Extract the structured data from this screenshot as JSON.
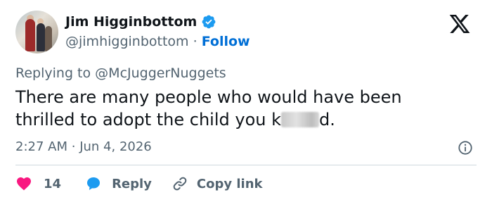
{
  "author": {
    "name": "Jim Higginbottom",
    "handle": "@jimhigginbottom",
    "separator": "·",
    "follow_label": "Follow",
    "verified_color": "#1d9bf0"
  },
  "reply_context": {
    "prefix": "Replying to",
    "mention": "@McJuggerNuggets"
  },
  "tweet": {
    "text_part1": "There are many people who would have been thrilled to adopt the child you k",
    "text_part2": "d."
  },
  "meta": {
    "time": "2:27 AM",
    "separator": "·",
    "date": "Jun 4, 2026"
  },
  "actions": {
    "like_count": "14",
    "reply_label": "Reply",
    "copy_label": "Copy link"
  },
  "colors": {
    "like": "#f91880",
    "reply": "#1d9bf0",
    "link": "#006fd6",
    "muted": "#536471"
  },
  "icons": [
    "verified-badge-icon",
    "x-logo-icon",
    "info-icon",
    "heart-icon",
    "reply-bubble-icon",
    "link-icon"
  ]
}
